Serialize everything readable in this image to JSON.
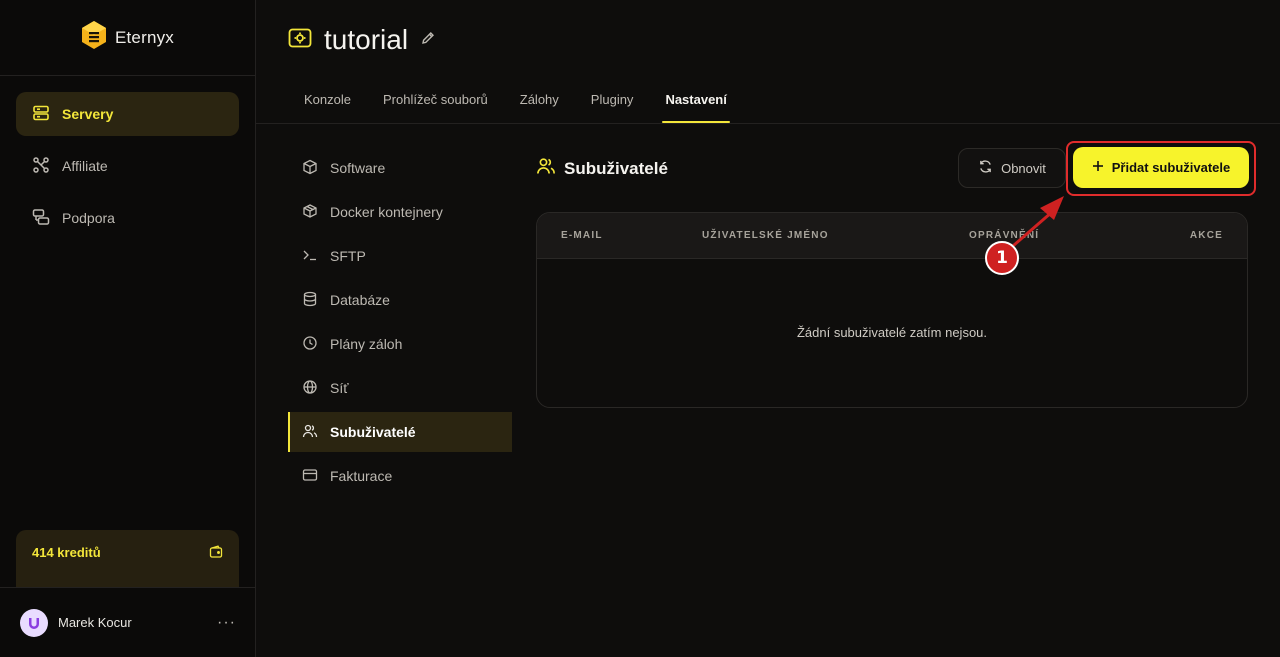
{
  "brand": {
    "name": "Eternyx"
  },
  "sidebar": {
    "items": [
      {
        "label": "Servery",
        "icon": "server-icon",
        "active": true
      },
      {
        "label": "Affiliate",
        "icon": "affiliate-icon",
        "active": false
      },
      {
        "label": "Podpora",
        "icon": "support-icon",
        "active": false
      }
    ],
    "credits": "414 kreditů",
    "user": {
      "name": "Marek Kocur",
      "more": "···"
    }
  },
  "header": {
    "title": "tutorial",
    "tabs": [
      {
        "label": "Konzole",
        "active": false
      },
      {
        "label": "Prohlížeč souborů",
        "active": false
      },
      {
        "label": "Zálohy",
        "active": false
      },
      {
        "label": "Pluginy",
        "active": false
      },
      {
        "label": "Nastavení",
        "active": true
      }
    ]
  },
  "settings_nav": [
    {
      "label": "Software",
      "icon": "cube-icon"
    },
    {
      "label": "Docker kontejnery",
      "icon": "box-icon"
    },
    {
      "label": "SFTP",
      "icon": "terminal-icon"
    },
    {
      "label": "Databáze",
      "icon": "database-icon"
    },
    {
      "label": "Plány záloh",
      "icon": "clock-icon"
    },
    {
      "label": "Síť",
      "icon": "globe-icon"
    },
    {
      "label": "Subuživatelé",
      "icon": "users-icon",
      "active": true
    },
    {
      "label": "Fakturace",
      "icon": "card-icon"
    }
  ],
  "content": {
    "section_title": "Subuživatelé",
    "refresh_label": "Obnovit",
    "add_label": "Přidat subuživatele",
    "table": {
      "columns": [
        "E-MAIL",
        "UŽIVATELSKÉ JMÉNO",
        "OPRÁVNĚNÍ",
        "AKCE"
      ],
      "empty_text": "Žádní subuživatelé zatím nejsou."
    }
  },
  "annotation": {
    "marker": "1"
  },
  "colors": {
    "accent": "#f3e63a",
    "button": "#f7f32b",
    "highlight": "#e02c2c",
    "background": "#0e0d0c"
  }
}
